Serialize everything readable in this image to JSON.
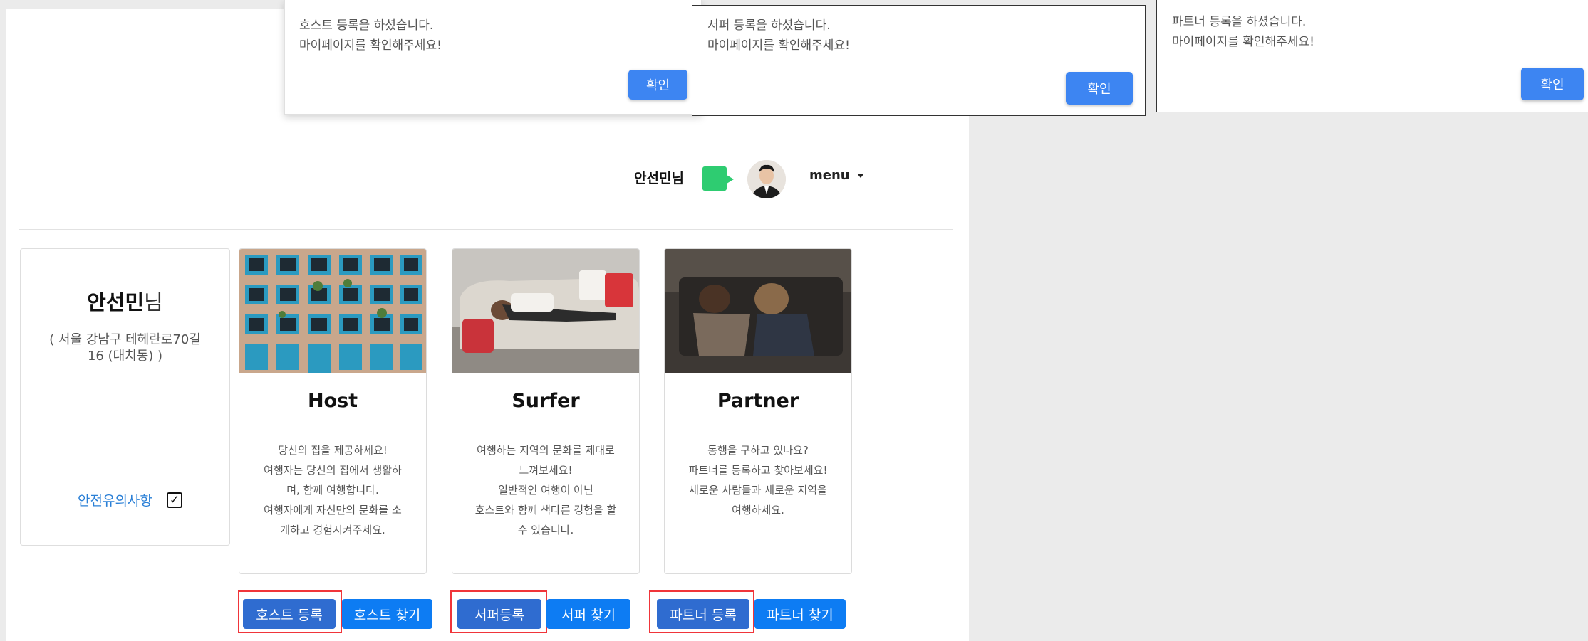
{
  "header": {
    "user_name": "안선민님",
    "menu_label": "menu"
  },
  "profile": {
    "name_bold": "안선민",
    "name_suffix": "님",
    "address": "( 서울 강남구 테헤란로70길 16 (대치동) )",
    "safety_link": "안전유의사항",
    "safety_checked": true
  },
  "cards": [
    {
      "title": "Host",
      "lines": [
        "당신의 집을 제공하세요!",
        "여행자는 당신의 집에서 생활하",
        "며, 함께 여행합니다.",
        "여행자에게 자신만의 문화를 소",
        "개하고 경험시켜주세요."
      ]
    },
    {
      "title": "Surfer",
      "lines": [
        "여행하는 지역의 문화를 제대로",
        "느껴보세요!",
        "일반적인 여행이 아닌",
        "호스트와 함께 색다른 경험을 할",
        "수 있습니다."
      ]
    },
    {
      "title": "Partner",
      "lines": [
        "동행을 구하고 있나요?",
        "파트너를 등록하고 찾아보세요!",
        "새로운 사람들과 새로운 지역을",
        "여행하세요."
      ]
    }
  ],
  "buttons": {
    "host_register": "호스트 등록",
    "host_find": "호스트 찾기",
    "surfer_register": "서퍼등록",
    "surfer_find": "서퍼 찾기",
    "partner_register": "파트너 등록",
    "partner_find": "파트너 찾기"
  },
  "dialogs": [
    {
      "line1": "호스트 등록을 하셨습니다.",
      "line2": "마이페이지를 확인해주세요!",
      "ok": "확인"
    },
    {
      "line1": "서퍼 등록을 하셨습니다.",
      "line2": "마이페이지를 확인해주세요!",
      "ok": "확인"
    },
    {
      "line1": "파트너 등록을 하셨습니다.",
      "line2": "마이페이지를 확인해주세요!",
      "ok": "확인"
    }
  ],
  "colors": {
    "primary_button": "#0d7cf3",
    "registered_button": "#2f6cd0",
    "highlight_box": "#f0353a",
    "chat_icon": "#2ecc71",
    "link": "#2a7fd6",
    "logo": "#f26522"
  },
  "icons": [
    "chat-bubble-icon",
    "avatar",
    "caret-down-icon",
    "checkbox-icon"
  ]
}
